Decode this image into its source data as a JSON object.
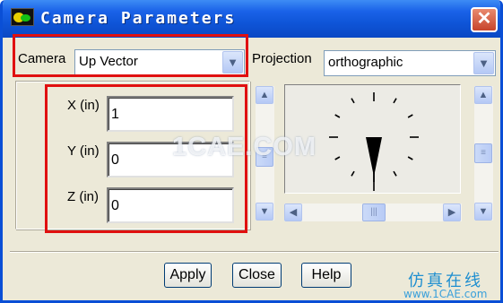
{
  "window": {
    "title": "Camera Parameters",
    "close_glyph": "✕"
  },
  "camera": {
    "label": "Camera",
    "selected": "Up Vector"
  },
  "projection": {
    "label": "Projection",
    "selected": "orthographic"
  },
  "fields": [
    {
      "label": "X (in)",
      "value": "1"
    },
    {
      "label": "Y (in)",
      "value": "0"
    },
    {
      "label": "Z (in)",
      "value": "0"
    }
  ],
  "buttons": {
    "apply": "Apply",
    "close": "Close",
    "help": "Help"
  },
  "watermark": {
    "center": "1CAE.COM",
    "corner_cn": "仿真在线",
    "corner_url": "www.1CAE.com"
  },
  "icons": {
    "dropdown": "chevron-down-icon",
    "scroll_up": "arrow-up-icon",
    "scroll_down": "arrow-down-icon",
    "scroll_left": "arrow-left-icon",
    "scroll_right": "arrow-right-icon"
  },
  "colors": {
    "titlebar": "#1a62e8",
    "highlight": "#e01010",
    "face": "#ece9d8"
  }
}
